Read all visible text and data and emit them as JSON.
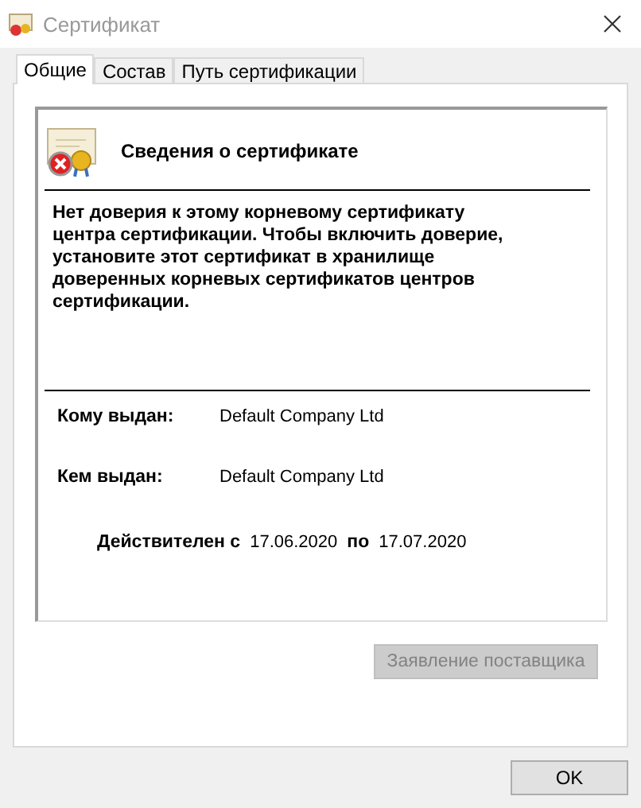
{
  "window": {
    "title": "Сертификат"
  },
  "tabs": [
    {
      "label": "Общие",
      "selected": true
    },
    {
      "label": "Состав",
      "selected": false
    },
    {
      "label": "Путь сертификации",
      "selected": false
    }
  ],
  "certificate": {
    "heading": "Сведения о сертификате",
    "warning": "Нет доверия к этому корневому сертификату центра сертификации. Чтобы включить  доверие, установите этот сертификат в хранилище доверенных корневых сертификатов центров сертификации.",
    "fields": [
      {
        "label": "Кому выдан:",
        "value": "Default Company Ltd"
      },
      {
        "label": "Кем выдан:",
        "value": "Default Company Ltd"
      }
    ],
    "validity": {
      "from_label": "Действителен с",
      "from": "17.06.2020",
      "to_label": "по",
      "to": "17.07.2020"
    }
  },
  "issuer_statement": {
    "label": "Заявление поставщика",
    "disabled": true
  },
  "ok_button": {
    "label": "OK"
  }
}
